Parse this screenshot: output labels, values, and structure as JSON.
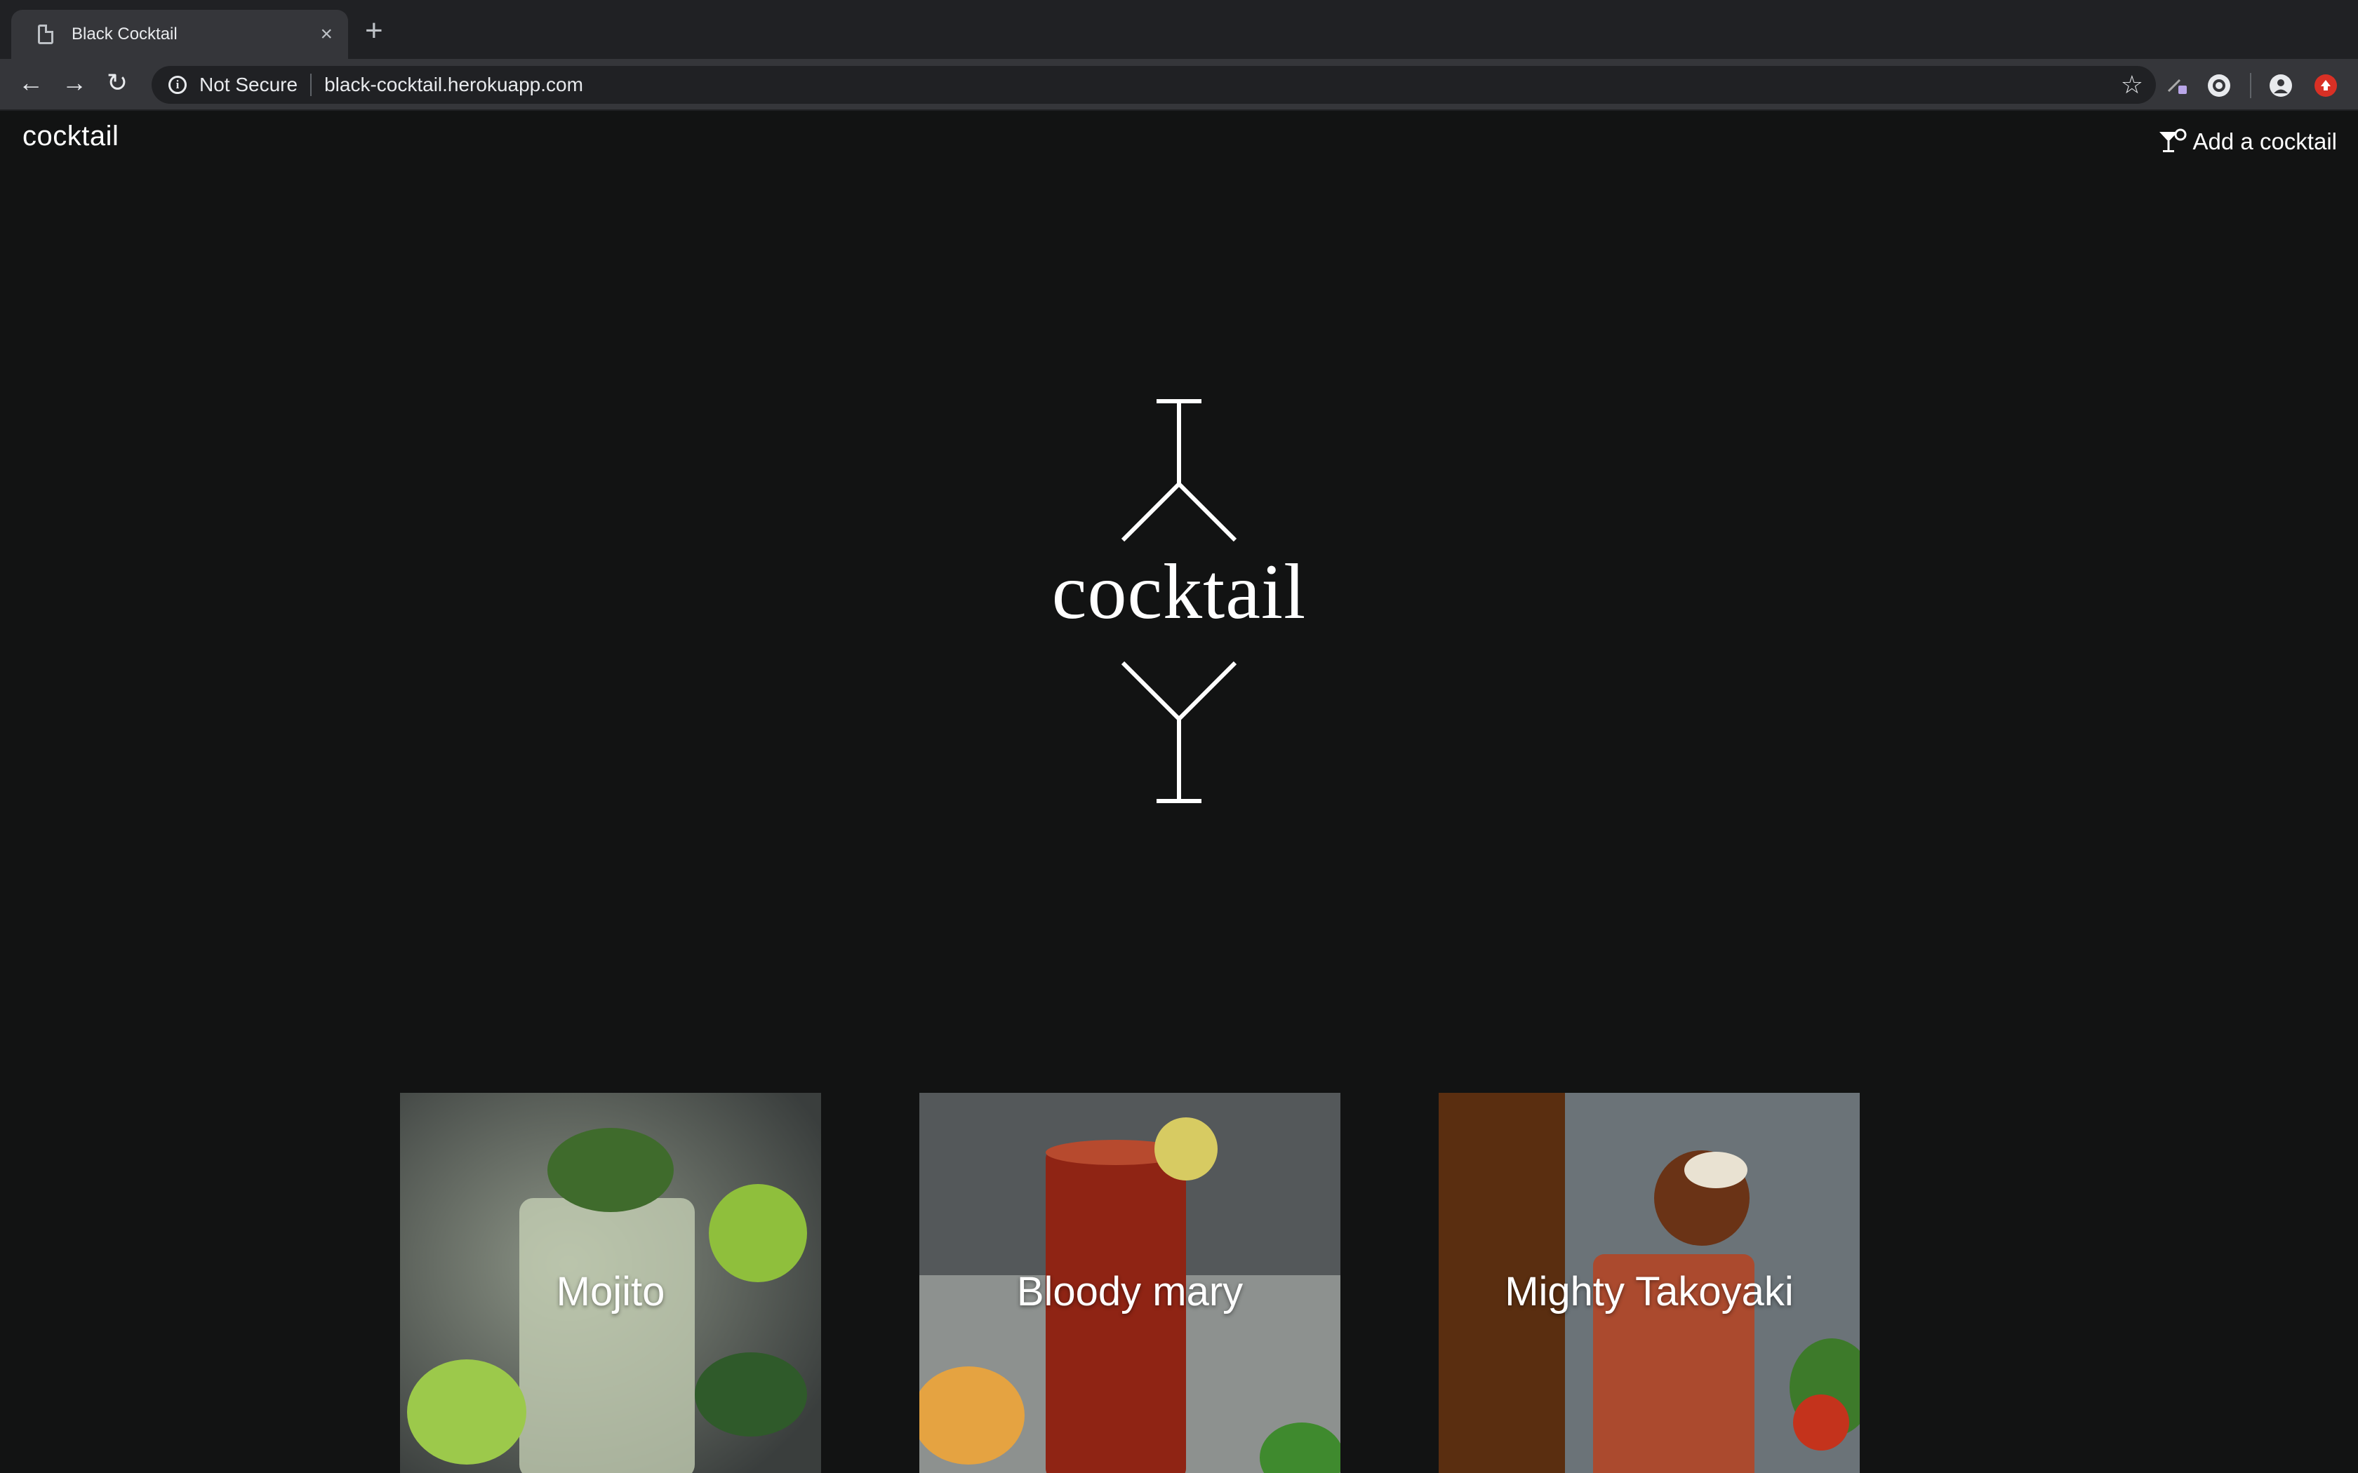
{
  "browser": {
    "tab_title": "Black Cocktail",
    "tab_close": "×",
    "new_tab": "+",
    "security_label": "Not Secure",
    "url": "black-cocktail.herokuapp.com"
  },
  "header": {
    "brand": "cocktail",
    "add_link": "Add a cocktail"
  },
  "hero": {
    "word": "cocktail"
  },
  "cards": [
    {
      "label": "Mojito"
    },
    {
      "label": "Bloody mary"
    },
    {
      "label": "Mighty Takoyaki"
    }
  ],
  "colors": {
    "page_bg": "#121313",
    "chrome_tabstrip": "#202124",
    "chrome_toolbar": "#35363a",
    "text": "#ffffff"
  }
}
